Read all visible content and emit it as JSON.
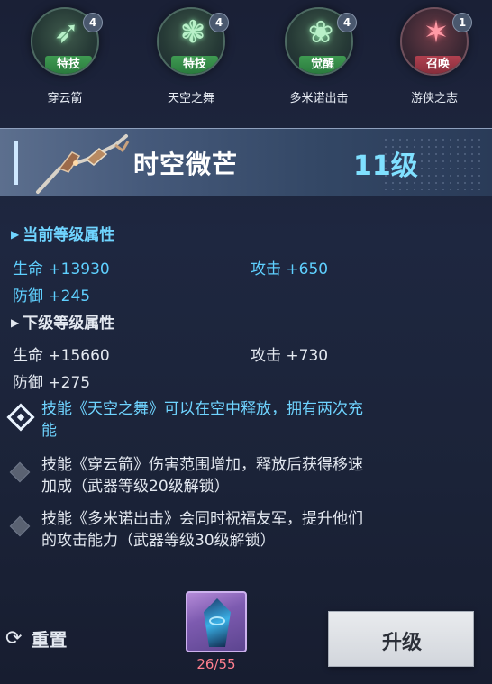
{
  "skills": [
    {
      "glyph": "➶",
      "type": "特技",
      "count": "4",
      "name": "穿云箭"
    },
    {
      "glyph": "❃",
      "type": "特技",
      "count": "4",
      "name": "天空之舞"
    },
    {
      "glyph": "❀",
      "type": "觉醒",
      "count": "4",
      "name": "多米诺出击"
    },
    {
      "glyph": "✶",
      "type": "召唤",
      "count": "1",
      "name": "游侠之志"
    }
  ],
  "weapon": {
    "title": "时空微芒",
    "level": "11级"
  },
  "current": {
    "title": "当前等级属性",
    "hp": "生命 +13930",
    "atk": "攻击 +650",
    "def": "防御 +245"
  },
  "next": {
    "title": "下级等级属性",
    "hp": "生命 +15660",
    "atk": "攻击 +730",
    "def": "防御 +275"
  },
  "notes": [
    {
      "line1": "技能《天空之舞》可以在空中释放，拥有两次充",
      "line2": "能"
    },
    {
      "line1": "技能《穿云箭》伤害范围增加，释放后获得移速",
      "line2": "加成（武器等级20级解锁）"
    },
    {
      "line1": "技能《多米诺出击》会同时祝福友军，提升他们",
      "line2": "的攻击能力（武器等级30级解锁）"
    }
  ],
  "bottom": {
    "reset_label": "重置",
    "material_count": "26/55",
    "upgrade_label": "升级"
  },
  "colors": {
    "accent": "#6fd4ff",
    "level": "#7fe0ff",
    "count_short": "#ff7f8e"
  }
}
